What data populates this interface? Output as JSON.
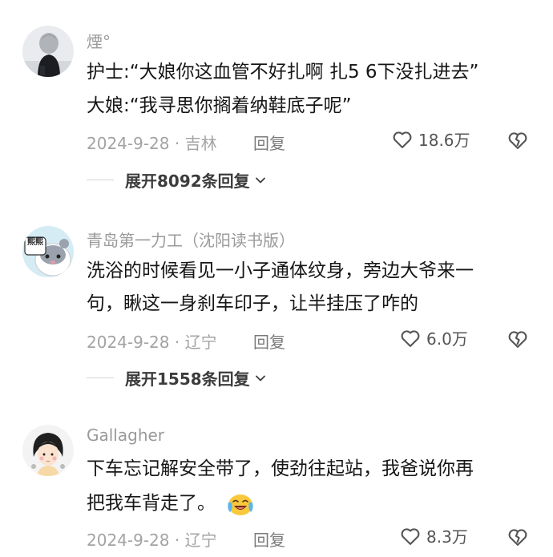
{
  "comments": [
    {
      "username": "煙°",
      "lines": [
        "护士:“大娘你这血管不好扎啊 扎5 6下没扎进去”",
        "大娘:“我寻思你搁着纳鞋底子呢”"
      ],
      "date_location": "2024-9-28 · 吉林",
      "reply_label": "回复",
      "likes": "18.6万",
      "expand_label": "展开8092条回复",
      "avatar_icon": "child-back-photo-avatar"
    },
    {
      "username": "青岛第一力工（沈阳读书版）",
      "lines": [
        "洗浴的时候看见一小子通体纹身，旁边大爷来一",
        "句，瞅这一身刹车印子，让半挂压了咋的"
      ],
      "date_location": "2024-9-28 · 辽宁",
      "reply_label": "回复",
      "likes": "6.0万",
      "expand_label": "展开1558条回复",
      "avatar_icon": "hamster-cartoon-avatar",
      "avatar_badge_text": "熙熙"
    },
    {
      "username": "Gallagher",
      "lines": [
        "下车忘记解安全带了，使劲往起站，我爸说你再",
        "把我车背走了。"
      ],
      "date_location": "2024-9-28 · 辽宁",
      "reply_label": "回复",
      "likes": "8.3万",
      "avatar_icon": "girl-cartoon-avatar",
      "emoji_icon": "crying-laughing-emoji"
    }
  ]
}
